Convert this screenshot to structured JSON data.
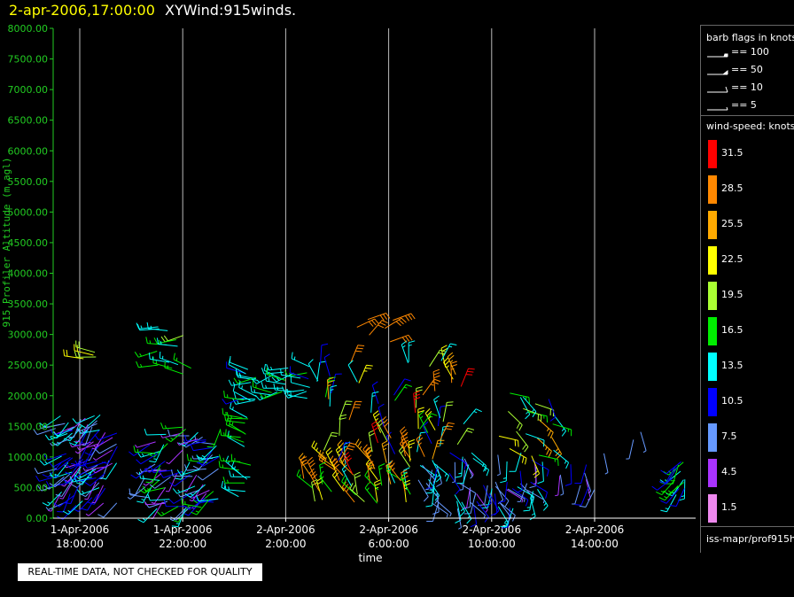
{
  "header": {
    "time_label": "2-apr-2006,17:00:00",
    "plot_label": "XYWind:915winds."
  },
  "chart_data": {
    "type": "scatter",
    "mark": "wind-barb",
    "ylabel": "915 Profiler Altitude (m agl)",
    "xlabel": "time",
    "ylim": [
      0,
      8000
    ],
    "y_ticks": [
      "0.00",
      "500.00",
      "1000.00",
      "1500.00",
      "2000.00",
      "2500.00",
      "3000.00",
      "3500.00",
      "4000.00",
      "4500.00",
      "5000.00",
      "5500.00",
      "6000.00",
      "6500.00",
      "7000.00",
      "7500.00",
      "8000.00"
    ],
    "x_ticks": [
      {
        "date": "1-Apr-2006",
        "time": "18:00:00"
      },
      {
        "date": "1-Apr-2006",
        "time": "22:00:00"
      },
      {
        "date": "2-Apr-2006",
        "time": "2:00:00"
      },
      {
        "date": "2-Apr-2006",
        "time": "6:00:00"
      },
      {
        "date": "2-Apr-2006",
        "time": "10:00:00"
      },
      {
        "date": "2-Apr-2006",
        "time": "14:00:00"
      }
    ],
    "grid": "vertical",
    "axis_color": "#22cc22",
    "clusters": [
      {
        "start": "1-Apr-2006 17:00",
        "end": "1-Apr-2006 19:30",
        "alt": [
          200,
          1700
        ],
        "n": 90,
        "speed": [
          3,
          15
        ],
        "dir": [
          200,
          260
        ]
      },
      {
        "start": "1-Apr-2006 20:30",
        "end": "1-Apr-2006 23:30",
        "alt": [
          150,
          1500
        ],
        "n": 80,
        "speed": [
          3,
          17
        ],
        "dir": [
          200,
          280
        ]
      },
      {
        "start": "1-Apr-2006 18:00",
        "end": "1-Apr-2006 18:40",
        "alt": [
          2600,
          2750
        ],
        "n": 4,
        "speed": [
          19,
          22
        ],
        "dir": [
          250,
          290
        ]
      },
      {
        "start": "1-Apr-2006 21:00",
        "end": "1-Apr-2006 22:30",
        "alt": [
          2300,
          3200
        ],
        "n": 14,
        "speed": [
          12,
          21
        ],
        "dir": [
          250,
          300
        ]
      },
      {
        "start": "2-Apr-2006 0:10",
        "end": "2-Apr-2006 0:40",
        "alt": [
          250,
          1800
        ],
        "n": 18,
        "speed": [
          13,
          18
        ],
        "dir": [
          270,
          320
        ]
      },
      {
        "start": "2-Apr-2006 0:20",
        "end": "2-Apr-2006 3:00",
        "alt": [
          1900,
          2500
        ],
        "n": 34,
        "speed": [
          11,
          16
        ],
        "dir": [
          240,
          300
        ]
      },
      {
        "start": "2-Apr-2006 2:40",
        "end": "2-Apr-2006 7:00",
        "alt": [
          200,
          1000
        ],
        "n": 45,
        "speed": [
          14,
          31
        ],
        "dir": [
          300,
          360
        ]
      },
      {
        "start": "2-Apr-2006 3:00",
        "end": "2-Apr-2006 9:00",
        "alt": [
          900,
          2600
        ],
        "n": 60,
        "speed": [
          9,
          31
        ],
        "dir": [
          330,
          40
        ]
      },
      {
        "start": "2-Apr-2006 4:30",
        "end": "2-Apr-2006 6:30",
        "alt": [
          2700,
          3300
        ],
        "n": 6,
        "speed": [
          25,
          31
        ],
        "dir": [
          40,
          80
        ]
      },
      {
        "start": "2-Apr-2006 7:00",
        "end": "2-Apr-2006 12:00",
        "alt": [
          150,
          1100
        ],
        "n": 70,
        "speed": [
          5,
          15
        ],
        "dir": [
          120,
          200
        ]
      },
      {
        "start": "2-Apr-2006 10:00",
        "end": "2-Apr-2006 12:30",
        "alt": [
          1000,
          2100
        ],
        "n": 20,
        "speed": [
          11,
          25
        ],
        "dir": [
          100,
          160
        ]
      },
      {
        "start": "2-Apr-2006 12:30",
        "end": "2-Apr-2006 14:30",
        "alt": [
          300,
          1100
        ],
        "n": 10,
        "speed": [
          5,
          12
        ],
        "dir": [
          150,
          210
        ]
      },
      {
        "start": "2-Apr-2006 15:30",
        "end": "2-Apr-2006 16:00",
        "alt": [
          1250,
          1600
        ],
        "n": 2,
        "speed": [
          5,
          9
        ],
        "dir": [
          150,
          200
        ]
      },
      {
        "start": "2-Apr-2006 17:00",
        "end": "2-Apr-2006 18:40",
        "alt": [
          300,
          1000
        ],
        "n": 35,
        "speed": [
          9,
          17
        ],
        "dir": [
          180,
          240
        ]
      }
    ]
  },
  "legend": {
    "flags_title": "barb flags in knots",
    "flags": [
      {
        "label": "== 100",
        "kind": "pennant"
      },
      {
        "label": "== 50",
        "kind": "triangle"
      },
      {
        "label": "== 10",
        "kind": "full"
      },
      {
        "label": "== 5",
        "kind": "half"
      }
    ],
    "speed_title": "wind-speed: knots",
    "speed_scale": [
      {
        "label": "31.5",
        "color": "#ff0000"
      },
      {
        "label": "28.5",
        "color": "#ff8800"
      },
      {
        "label": "25.5",
        "color": "#ffaa00"
      },
      {
        "label": "22.5",
        "color": "#ffff00"
      },
      {
        "label": "19.5",
        "color": "#aaff33"
      },
      {
        "label": "16.5",
        "color": "#00ee00"
      },
      {
        "label": "13.5",
        "color": "#00ffff"
      },
      {
        "label": "10.5",
        "color": "#0000ff"
      },
      {
        "label": "7.5",
        "color": "#6699ff"
      },
      {
        "label": "4.5",
        "color": "#aa33ff"
      },
      {
        "label": "1.5",
        "color": "#ee88ee"
      }
    ],
    "source": "iss-mapr/prof915h"
  },
  "notice": "REAL-TIME DATA, NOT CHECKED FOR QUALITY"
}
